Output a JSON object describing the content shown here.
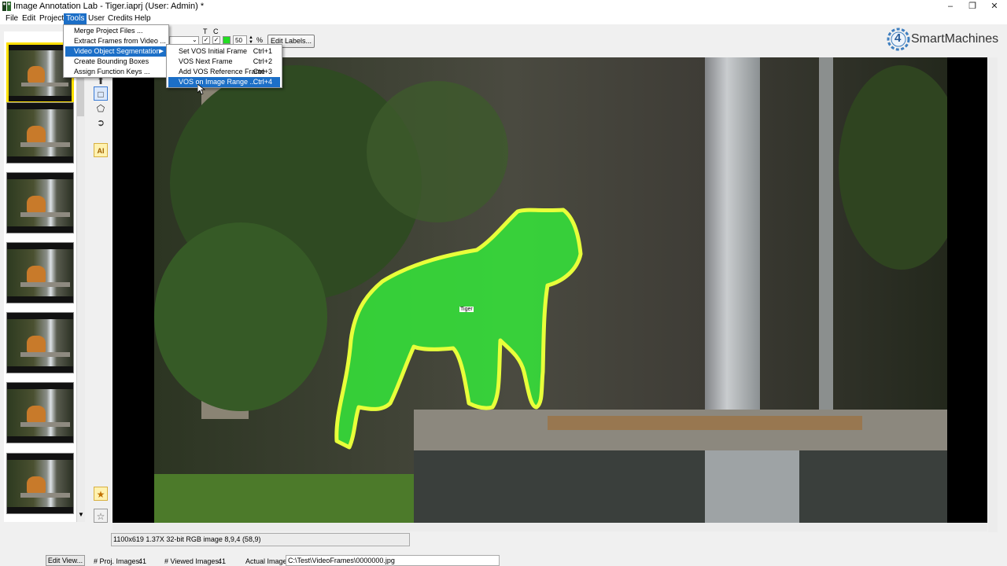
{
  "window": {
    "title": "Image Annotation Lab - Tiger.iaprj  (User: Admin) *"
  },
  "menu": [
    "File",
    "Edit",
    "Project",
    "Tools",
    "User",
    "Credits",
    "Help"
  ],
  "tools_menu": {
    "items": [
      "Merge Project Files ...",
      "Extract Frames from Video ...",
      "Video Object Segmentation",
      "Create Bounding Boxes",
      "Assign Function Keys ..."
    ],
    "highlighted": "Video Object Segmentation"
  },
  "vos_submenu": {
    "items": [
      {
        "label": "Set VOS Initial Frame",
        "shortcut": "Ctrl+1"
      },
      {
        "label": "VOS Next Frame",
        "shortcut": "Ctrl+2"
      },
      {
        "label": "Add VOS Reference Frame",
        "shortcut": "Ctrl+3"
      },
      {
        "label": "VOS on Image Range ...",
        "shortcut": "Ctrl+4"
      }
    ],
    "highlighted": "VOS on Image Range ..."
  },
  "toolbar": {
    "t_label": "T",
    "c_label": "C",
    "opacity_value": "50",
    "opacity_unit": "%",
    "edit_labels": "Edit Labels...",
    "accent_color": "#22dd22"
  },
  "logo": {
    "number": "4",
    "text": "SmartMachines"
  },
  "annotation": {
    "label": "Tiger",
    "fill_color": "#35e83a",
    "outline_color": "#e8ff3a"
  },
  "status": {
    "info": "1100x619 1.37X 32-bit RGB image 8,9,4    (58,9)",
    "edit_view": "Edit View...",
    "proj_images_label": "# Proj. Images:",
    "proj_images": "41",
    "viewed_images_label": "# Viewed Images:",
    "viewed_images": "41",
    "actual_image_label": "Actual Image:",
    "actual_image_path": "C:\\Test\\VideoFrames\\0000000.jpg"
  },
  "icons": [
    "app-icon",
    "minimize-icon",
    "maximize-icon",
    "close-icon",
    "select-arrow-icon",
    "pointer-icon",
    "rectangle-icon",
    "polygon-icon",
    "lasso-icon",
    "ai-icon",
    "magic-star-icon",
    "magic-star-edit-icon",
    "checkbox-icon"
  ]
}
